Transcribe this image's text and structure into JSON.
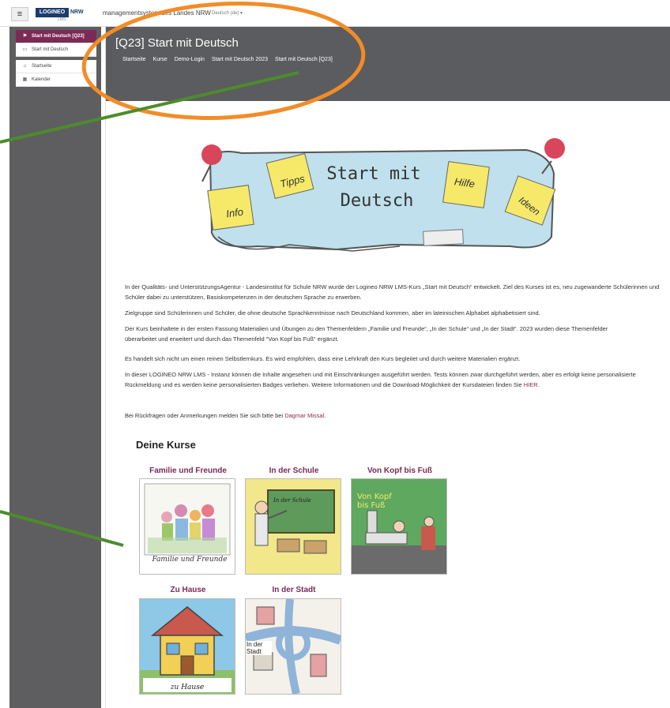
{
  "navbar": {
    "menu_icon": "menu-icon",
    "logo_text": "LOGINEO",
    "logo_nrw": "NRW",
    "logo_sub": "LMS",
    "site_title": "managementsystem des Landes NRW",
    "language": "Deutsch (de) ▾"
  },
  "drawer": {
    "items": [
      {
        "label": "Start mit Deutsch [Q23]",
        "icon": "graduation-cap-icon"
      },
      {
        "label": "Start mit Deutsch",
        "icon": "folder-icon"
      },
      {
        "label": "Startseite",
        "icon": "home-icon"
      },
      {
        "label": "Kalender",
        "icon": "calendar-icon"
      }
    ]
  },
  "header": {
    "title": "[Q23] Start mit Deutsch",
    "breadcrumb": [
      "Startseite",
      "Kurse",
      "Demo-Login",
      "Start mit Deutsch 2023",
      "Start mit Deutsch [Q23]"
    ]
  },
  "banner": {
    "line1": "Start mit",
    "line2": "Deutsch",
    "notes": [
      "Info",
      "Tipps",
      "Hilfe",
      "Ideen"
    ]
  },
  "intro": {
    "p1": "In der Qualitäts- und UnterstützungsAgentur - Landesinstitut für Schule NRW wurde der Logineo NRW LMS-Kurs „Start mit Deutsch“ entwickelt. Ziel des Kurses ist es, neu zugewanderte Schülerinnen und Schüler dabei zu unterstützen, Basiskompetenzen in der deutschen Sprache zu erwerben.",
    "p2": "Zielgruppe sind Schülerinnen und Schüler, die ohne deutsche Sprachkenntnisse nach Deutschland kommen, aber im lateinischen Alphabet alphabetisiert sind.",
    "p3": "Der Kurs beinhaltete in der ersten Fassung Materialien und Übungen zu den Themenfeldern „Familie und Freunde“, „In der Schule“ und „In der Stadt“. 2023 wurden diese Themenfelder überarbeitet und erweitert und durch das Themenfeld \"Von Kopf bis Fuß\" ergänzt.",
    "p4": "Es handelt sich nicht um einen reinen Selbstlernkurs. Es wird empfohlen, dass eine Lehrkraft den Kurs begleitet und durch weitere Materialien ergänzt.",
    "p5": "In dieser LOGINEO NRW LMS - Instanz können die Inhalte angesehen und mit Einschränkungen ausgeführt werden. Tests können zwar durchgeführt werden, aber es erfolgt keine personalisierte Rückmeldung und es werden keine personalisierten Badges verliehen. Weitere Informationen und die Download-Möglichkeit der Kursdateien finden Sie",
    "p5_link": "HIER",
    "p5_end": ".",
    "p6": "Bei Rückfragen oder Anmerkungen melden Sie sich bitte bei",
    "p6_link": "Dagmar Missal",
    "p6_end": "."
  },
  "courses": {
    "heading": "Deine Kurse",
    "items": [
      {
        "title": "Familie und Freunde",
        "caption": "Familie und Freunde"
      },
      {
        "title": "In der Schule",
        "caption": "In der Schule"
      },
      {
        "title": "Von Kopf bis Fuß",
        "caption": "Von Kopf bis Fuß"
      },
      {
        "title": "Zu Hause",
        "caption": "zu Hause"
      },
      {
        "title": "In der Stadt",
        "caption": "In der Stadt"
      }
    ]
  },
  "colors": {
    "accent": "#7b2a56",
    "header_bg": "#5b5c5f",
    "annotation_orange": "#f28c28",
    "annotation_green": "#4c8c2b"
  }
}
